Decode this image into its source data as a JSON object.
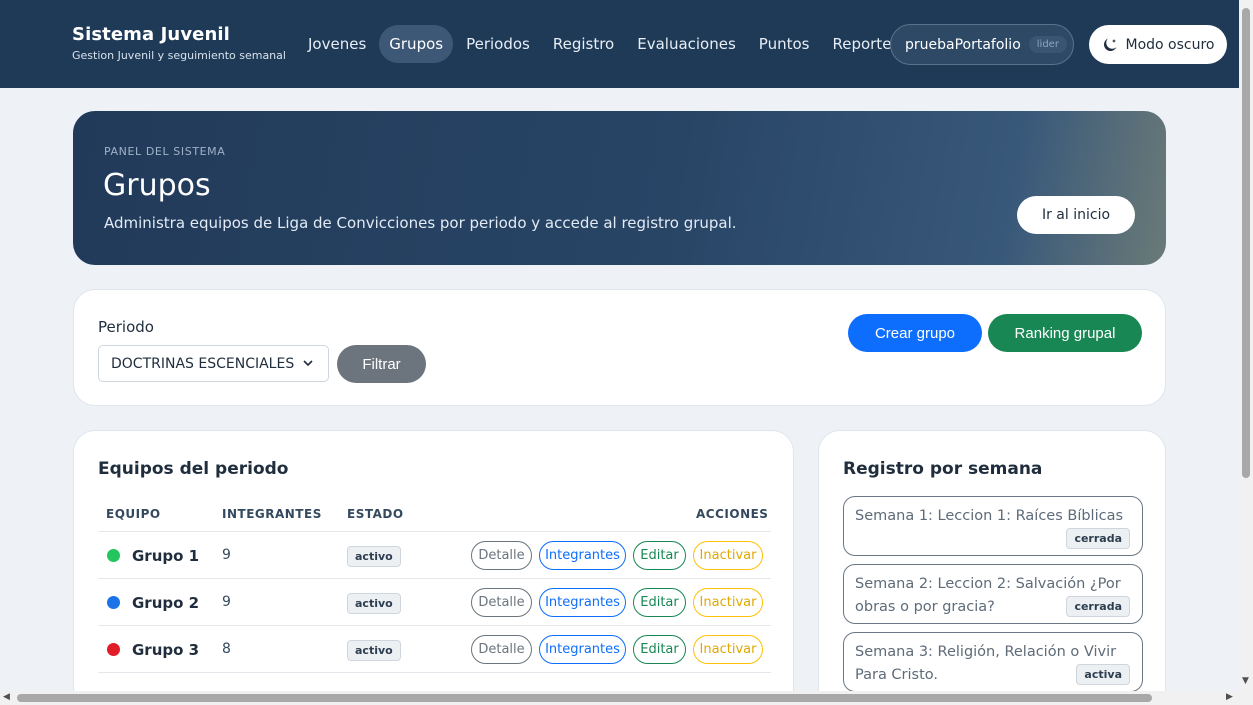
{
  "navbar": {
    "brand_title": "Sistema Juvenil",
    "brand_subtitle": "Gestion Juvenil y seguimiento semanal",
    "links": [
      "Jovenes",
      "Grupos",
      "Periodos",
      "Registro",
      "Evaluaciones",
      "Puntos",
      "Reportes"
    ],
    "active_link": "Grupos",
    "user_name": "pruebaPortafolio",
    "user_role": "lider",
    "dark_mode_label": "Modo oscuro"
  },
  "hero": {
    "eyebrow": "PANEL DEL SISTEMA",
    "title": "Grupos",
    "description": "Administra equipos de Liga de Convicciones por periodo y accede al registro grupal.",
    "home_button": "Ir al inicio"
  },
  "filter": {
    "label": "Periodo",
    "selected_period": "DOCTRINAS ESCENCIALES",
    "filter_button": "Filtrar",
    "create_button": "Crear grupo",
    "ranking_button": "Ranking grupal"
  },
  "teams": {
    "title": "Equipos del periodo",
    "headers": {
      "team": "EQUIPO",
      "members": "INTEGRANTES",
      "status": "ESTADO",
      "actions": "ACCIONES"
    },
    "action_labels": {
      "detail": "Detalle",
      "members": "Integrantes",
      "edit": "Editar",
      "deactivate": "Inactivar"
    },
    "rows": [
      {
        "name": "Grupo 1",
        "members": "9",
        "status": "activo",
        "color": "#22c55e"
      },
      {
        "name": "Grupo 2",
        "members": "9",
        "status": "activo",
        "color": "#1a73e8"
      },
      {
        "name": "Grupo 3",
        "members": "8",
        "status": "activo",
        "color": "#e11d2a"
      }
    ]
  },
  "weeks": {
    "title": "Registro por semana",
    "items": [
      {
        "label": "Semana 1: Leccion 1: Raíces Bíblicas",
        "status": "cerrada"
      },
      {
        "label": "Semana 2: Leccion 2: Salvación ¿Por obras o por gracia?",
        "status": "cerrada"
      },
      {
        "label": "Semana 3: Religión, Relación o Vivir Para Cristo.",
        "status": "activa"
      }
    ]
  }
}
